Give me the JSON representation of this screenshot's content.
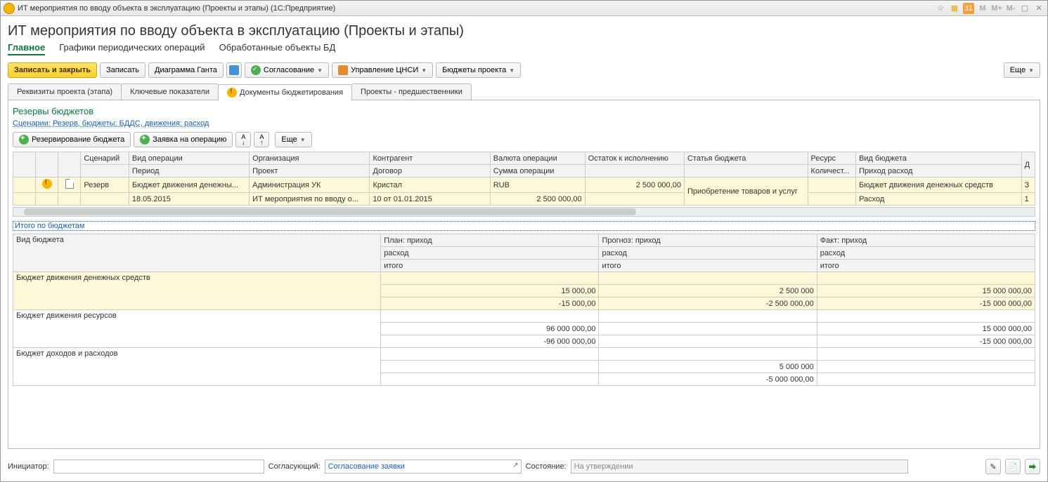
{
  "titlebar": {
    "app": "ИТ мероприятия по вводу объекта в эксплуатацию (Проекты и этапы)  (1С:Предприятие)",
    "m_labels": [
      "M",
      "M+",
      "M-"
    ]
  },
  "page_title": "ИТ мероприятия по вводу объекта в эксплуатацию (Проекты и этапы)",
  "nav": {
    "main": "Главное",
    "schedules": "Графики периодических операций",
    "processed": "Обработанные объекты БД"
  },
  "toolbar": {
    "save_close": "Записать и закрыть",
    "save": "Записать",
    "gantt": "Диаграмма Ганта",
    "approval": "Согласование",
    "cns": "Управление ЦНСИ",
    "budgets": "Бюджеты проекта",
    "more": "Еще"
  },
  "inner_tabs": {
    "reqs": "Реквизиты проекта (этапа)",
    "kpi": "Ключевые показатели",
    "docs": "Документы бюджетирования",
    "preds": "Проекты - предшественники"
  },
  "section": {
    "title": "Резервы бюджетов",
    "filter_link": "Сценарии: Резерв, бюджеты: БДДС, движения: расход",
    "reserve_btn": "Резервирование бюджета",
    "request_btn": "Заявка на операцию",
    "more": "Еще"
  },
  "grid1": {
    "headers": {
      "scenario": "Сценарий",
      "op_type": "Вид операции",
      "period": "Период",
      "org": "Организация",
      "project": "Проект",
      "contractor": "Контрагент",
      "contract": "Договор",
      "currency": "Валюта операции",
      "sum": "Сумма операции",
      "balance": "Остаток к исполнению",
      "article": "Статья бюджета",
      "resource": "Ресурс",
      "qty": "Количест...",
      "budget_type": "Вид бюджета",
      "inout": "Приход расход"
    },
    "row": {
      "scenario": "Резерв",
      "op_type": "Бюджет движения денежны...",
      "period": "18.05.2015",
      "org": "Администрация УК",
      "project": "ИТ мероприятия по вводу о...",
      "contractor": "Кристал",
      "contract": "10 от 01.01.2015",
      "currency": "RUB",
      "sum": "2 500 000,00",
      "balance": "2 500 000,00",
      "article": "Приобретение товаров и услуг",
      "budget_type": "Бюджет движения денежных средств",
      "inout": "Расход",
      "tail1": "З",
      "tail2": "1"
    }
  },
  "totals_link": "Итого по бюджетам",
  "grid2": {
    "headers": {
      "budget_type": "Вид бюджета",
      "plan_in": "План: приход",
      "forecast_in": "Прогноз: приход",
      "fact_in": "Факт: приход",
      "out": "расход",
      "total": "итого"
    },
    "rows": [
      {
        "name": "Бюджет движения денежных средств",
        "highlight": true,
        "plan_out": "15 000,00",
        "plan_total": "-15 000,00",
        "forecast_out": "2 500 000",
        "forecast_total": "-2 500 000,00",
        "fact_out": "15 000 000,00",
        "fact_total": "-15 000 000,00"
      },
      {
        "name": "Бюджет движения ресурсов",
        "plan_out": "96 000 000,00",
        "plan_total": "-96 000 000,00",
        "forecast_out": "",
        "forecast_total": "",
        "fact_out": "15 000 000,00",
        "fact_total": "-15 000 000,00"
      },
      {
        "name": "Бюджет доходов и расходов",
        "plan_out": "",
        "plan_total": "",
        "forecast_out": "5 000 000",
        "forecast_total": "-5 000 000,00",
        "fact_out": "",
        "fact_total": ""
      }
    ]
  },
  "footer": {
    "initiator_label": "Инициатор:",
    "approver_label": "Согласующий:",
    "approver_value": "Согласование заявки",
    "state_label": "Состояние:",
    "state_value": "На утверждении"
  }
}
